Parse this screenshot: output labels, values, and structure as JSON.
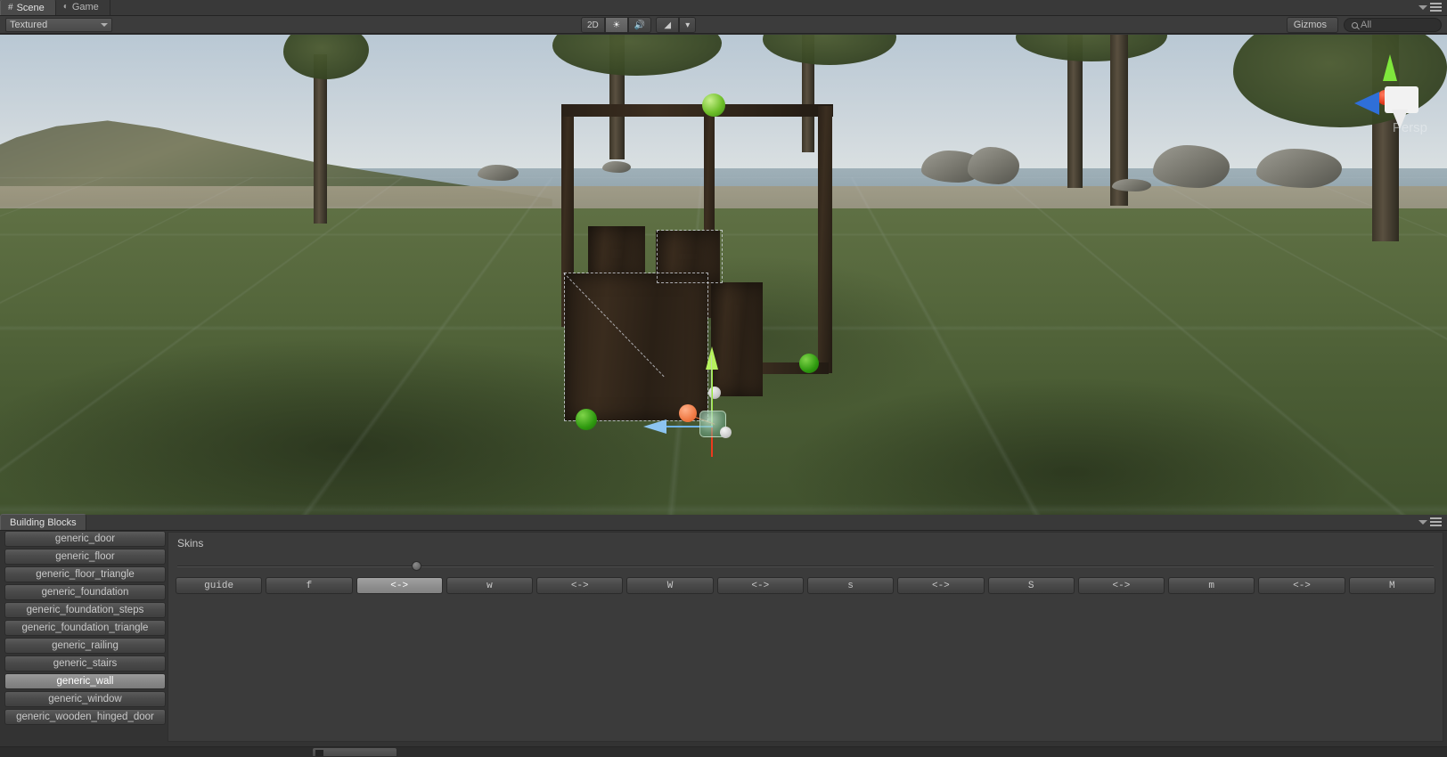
{
  "window": {
    "tabs": [
      {
        "label": "Scene",
        "icon": "grid-hash-icon",
        "active": true
      },
      {
        "label": "Game",
        "icon": "gamepad-icon",
        "active": false
      }
    ],
    "menu_icon": "hamburger-menu-icon",
    "dropdown_icon": "chevron-down-icon"
  },
  "scene_toolbar": {
    "draw_mode": {
      "value": "Textured",
      "icon": "chevron-down-icon"
    },
    "toggles": [
      {
        "name": "2d-toggle",
        "label": "2D",
        "active": false
      },
      {
        "name": "lighting-toggle",
        "label": "☀",
        "active": true
      },
      {
        "name": "audio-toggle",
        "label": "🔊",
        "active": false
      },
      {
        "name": "effects-toggle",
        "label": "◢",
        "active": false
      },
      {
        "name": "effects-dropdown",
        "label": "▾",
        "active": false
      }
    ],
    "gizmos": {
      "label": "Gizmos",
      "icon": "chevron-down-icon"
    },
    "search": {
      "value": "",
      "placeholder": "All",
      "icon": "search-icon"
    }
  },
  "viewport": {
    "scene_gizmo": {
      "label": "Persp",
      "axes": [
        {
          "name": "y-axis-cone",
          "label": "Y",
          "color": "#7fe83c"
        },
        {
          "name": "x-axis-cone",
          "label": "X",
          "color": "#e8462c"
        },
        {
          "name": "z-axis-cone",
          "label": "Z",
          "color": "#3a77e0"
        }
      ]
    },
    "transform_gizmo": {
      "name": "move-gizmo",
      "axis_colors": {
        "x": "#e8502a",
        "y": "#9ae83c",
        "z": "#5aa8e8"
      }
    },
    "selection": {
      "object": "generic_wall",
      "snap_handles": 4,
      "handle_color": "#5fbc22"
    },
    "colors": {
      "sky": "#c3cfd8",
      "grass": "#546639",
      "wood": "#33281b",
      "grid": "#c8d2dc"
    }
  },
  "bottom_panel": {
    "tab": {
      "label": "Building Blocks",
      "active": true
    },
    "menu_icon": "hamburger-menu-icon",
    "dropdown_icon": "chevron-down-icon",
    "blocks": [
      {
        "label": "generic_door",
        "selected": false
      },
      {
        "label": "generic_floor",
        "selected": false
      },
      {
        "label": "generic_floor_triangle",
        "selected": false
      },
      {
        "label": "generic_foundation",
        "selected": false
      },
      {
        "label": "generic_foundation_steps",
        "selected": false
      },
      {
        "label": "generic_foundation_triangle",
        "selected": false
      },
      {
        "label": "generic_railing",
        "selected": false
      },
      {
        "label": "generic_stairs",
        "selected": false
      },
      {
        "label": "generic_wall",
        "selected": true
      },
      {
        "label": "generic_window",
        "selected": false
      },
      {
        "label": "generic_wooden_hinged_door",
        "selected": false
      }
    ],
    "skins": {
      "title": "Skins",
      "slider": {
        "value": 19,
        "min": 0,
        "max": 100
      },
      "buttons": [
        {
          "label": "guide",
          "selected": false
        },
        {
          "label": "f",
          "selected": false
        },
        {
          "label": "<->",
          "selected": true
        },
        {
          "label": "w",
          "selected": false
        },
        {
          "label": "<->",
          "selected": false
        },
        {
          "label": "W",
          "selected": false
        },
        {
          "label": "<->",
          "selected": false
        },
        {
          "label": "s",
          "selected": false
        },
        {
          "label": "<->",
          "selected": false
        },
        {
          "label": "S",
          "selected": false
        },
        {
          "label": "<->",
          "selected": false
        },
        {
          "label": "m",
          "selected": false
        },
        {
          "label": "<->",
          "selected": false
        },
        {
          "label": "M",
          "selected": false
        }
      ]
    }
  }
}
